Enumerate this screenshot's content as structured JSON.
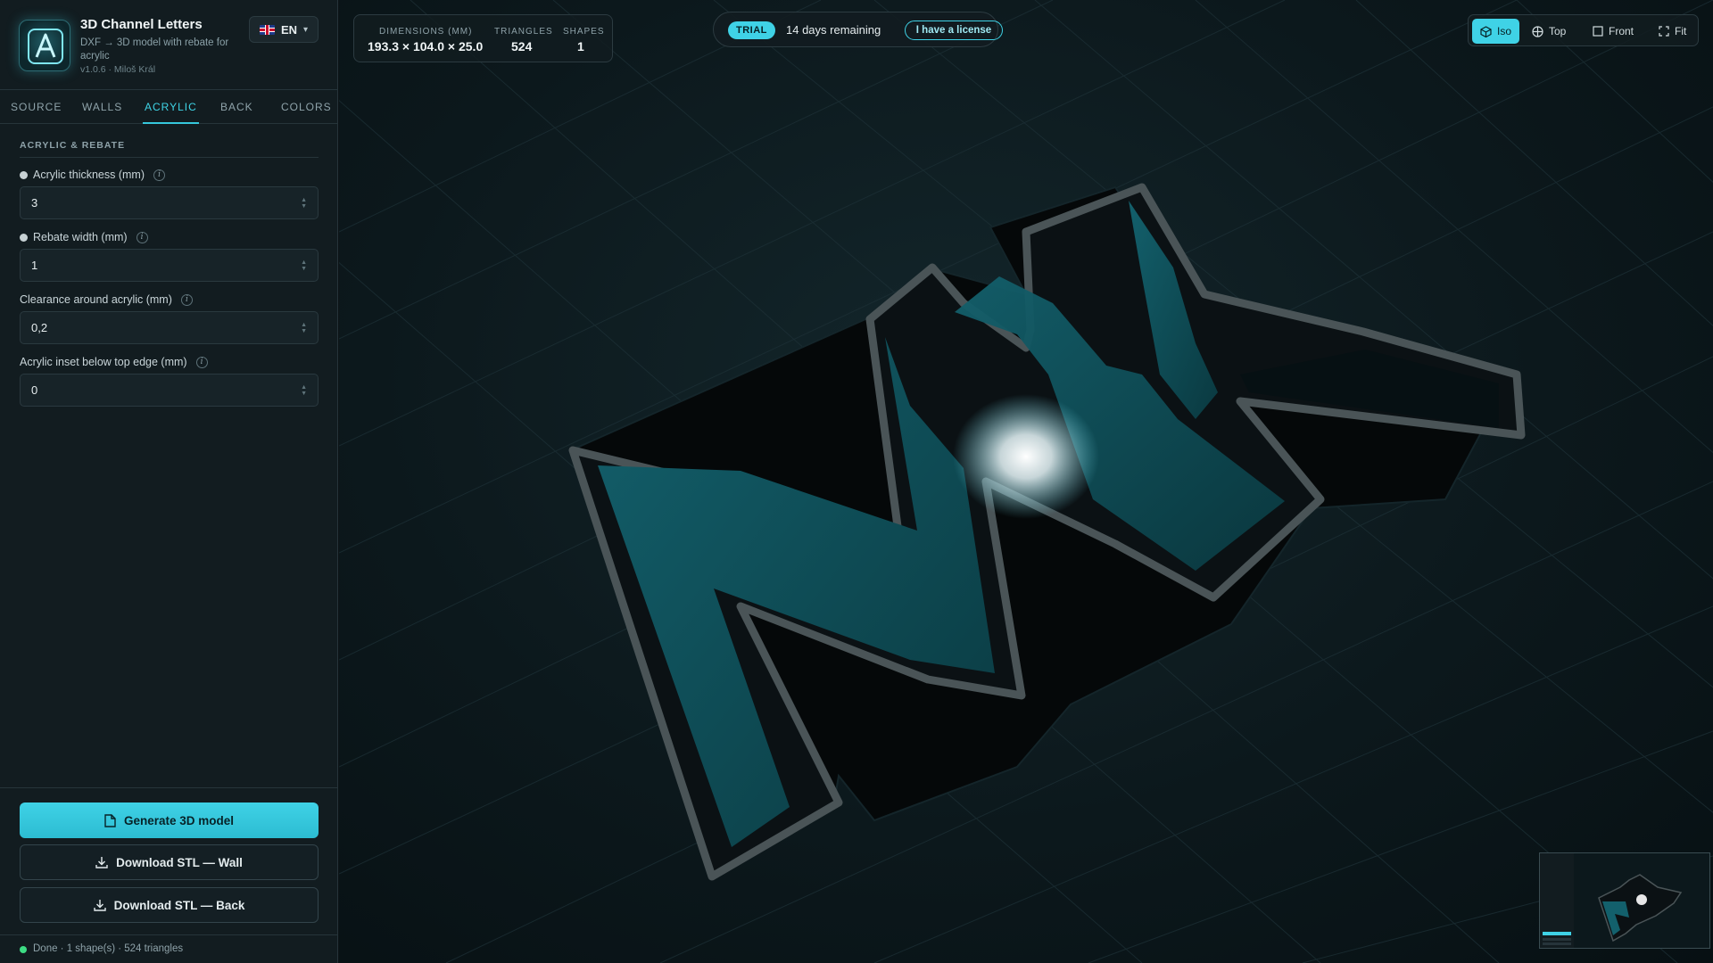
{
  "app": {
    "title": "3D Channel Letters",
    "subtitle": "DXF → 3D model with rebate for acrylic",
    "version": "v1.0.6 · Miloš Král"
  },
  "language": {
    "code": "EN",
    "flag": "uk-flag-icon"
  },
  "tabs": [
    {
      "label": "SOURCE",
      "active": false
    },
    {
      "label": "WALLS",
      "active": false
    },
    {
      "label": "ACRYLIC",
      "active": true
    },
    {
      "label": "BACK",
      "active": false
    },
    {
      "label": "COLORS",
      "active": false
    }
  ],
  "section": {
    "title": "ACRYLIC & REBATE"
  },
  "fields": [
    {
      "label": "Acrylic thickness (mm)",
      "value": "3",
      "has_dot": true
    },
    {
      "label": "Rebate width (mm)",
      "value": "1",
      "has_dot": true
    },
    {
      "label": "Clearance around acrylic (mm)",
      "value": "0,2",
      "has_dot": false
    },
    {
      "label": "Acrylic inset below top edge (mm)",
      "value": "0",
      "has_dot": false
    }
  ],
  "actions": {
    "generate": "Generate 3D model",
    "download_wall": "Download STL — Wall",
    "download_back": "Download STL — Back"
  },
  "status": {
    "text": "Done · 1 shape(s) · 524 triangles",
    "color": "#3ddc84"
  },
  "stats": {
    "dimensions_label": "DIMENSIONS (MM)",
    "dimensions_value": "193.3 × 104.0 × 25.0",
    "triangles_label": "TRIANGLES",
    "triangles_value": "524",
    "shapes_label": "SHAPES",
    "shapes_value": "1"
  },
  "trial": {
    "badge": "TRIAL",
    "text": "14 days remaining",
    "button": "I have a license"
  },
  "view_buttons": [
    {
      "label": "Iso",
      "icon": "cube-icon",
      "active": true
    },
    {
      "label": "Top",
      "icon": "globe-icon",
      "active": false
    },
    {
      "label": "Front",
      "icon": "square-icon",
      "active": false
    },
    {
      "label": "Fit",
      "icon": "fit-icon",
      "active": false
    }
  ],
  "colors": {
    "accent": "#3fd2e6",
    "panel": "#121c20",
    "viewport_bg": "#0c181c",
    "letter_inner": "#0f4f5a"
  }
}
